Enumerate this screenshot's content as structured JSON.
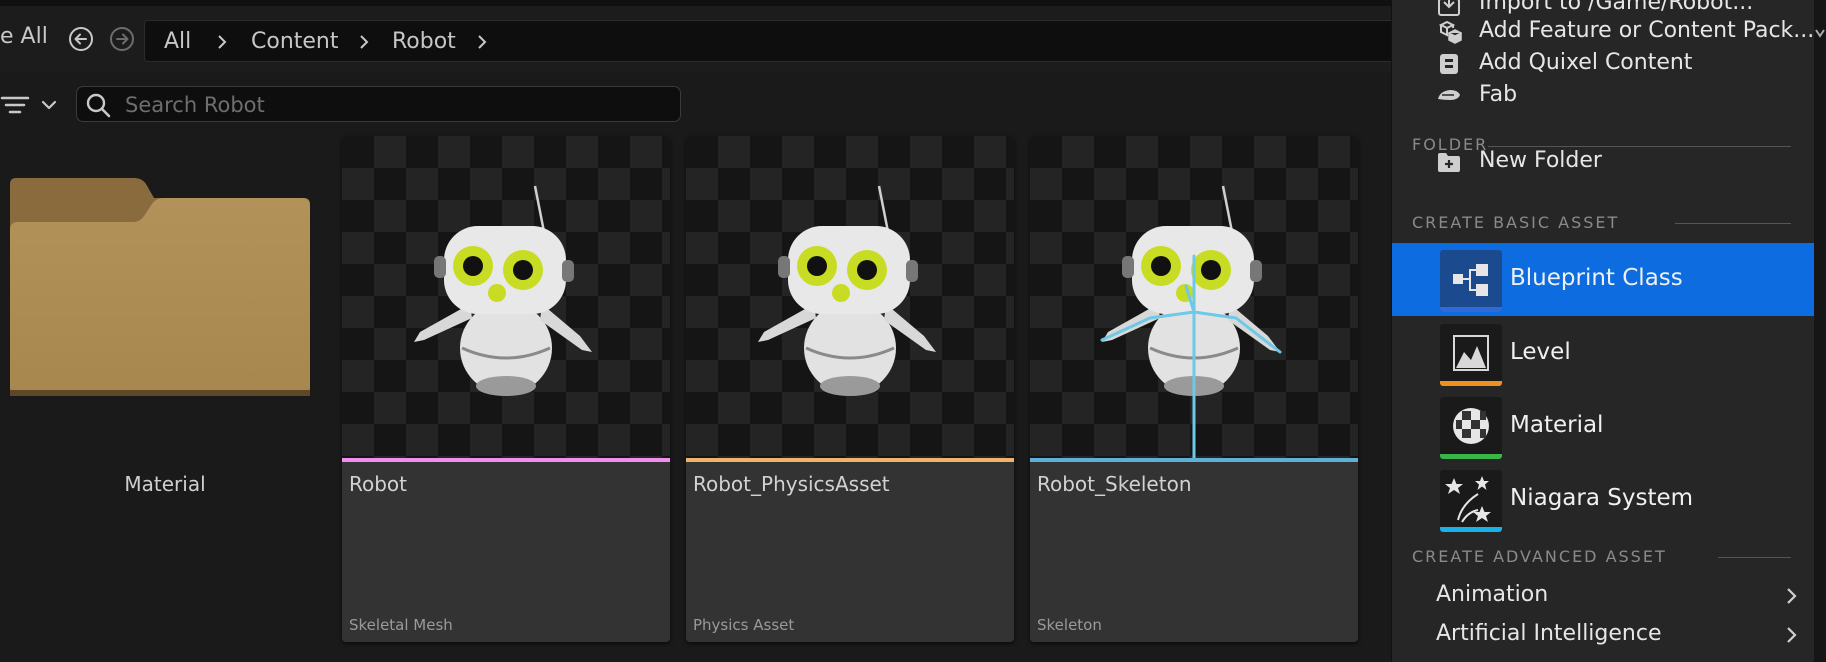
{
  "toolbar": {
    "save_all_label": "e All",
    "breadcrumb": [
      "All",
      "Content",
      "Robot"
    ]
  },
  "search": {
    "placeholder": "Search Robot",
    "value": ""
  },
  "assets": [
    {
      "name": "Material",
      "kind": "folder"
    },
    {
      "name": "Robot",
      "type": "Skeletal Mesh",
      "color": "#f08ef0"
    },
    {
      "name": "Robot_PhysicsAsset",
      "type": "Physics Asset",
      "color": "#f1b36c"
    },
    {
      "name": "Robot_Skeleton",
      "type": "Skeleton",
      "color": "#5fb0d8"
    }
  ],
  "menu": {
    "top_items": [
      {
        "label": "Import to /Game/Robot...",
        "icon": "import-icon"
      },
      {
        "label": "Add Feature or Content Pack...",
        "icon": "feature-pack-icon"
      },
      {
        "label": "Add Quixel Content",
        "icon": "quixel-icon"
      },
      {
        "label": "Fab",
        "icon": "fab-icon"
      }
    ],
    "folder_section": "FOLDER",
    "new_folder": "New Folder",
    "basic_section": "CREATE BASIC ASSET",
    "basic_items": [
      {
        "label": "Blueprint Class",
        "icon": "blueprint-icon",
        "color": "#2e6bd9",
        "selected": true
      },
      {
        "label": "Level",
        "icon": "level-icon",
        "color": "#f0911e",
        "selected": false
      },
      {
        "label": "Material",
        "icon": "material-icon",
        "color": "#3ab54a",
        "selected": false
      },
      {
        "label": "Niagara System",
        "icon": "niagara-icon",
        "color": "#1ab0e8",
        "selected": false
      }
    ],
    "advanced_section": "CREATE ADVANCED ASSET",
    "advanced_items": [
      {
        "label": "Animation"
      },
      {
        "label": "Artificial Intelligence"
      }
    ],
    "selection_color": "#0d6de0"
  }
}
